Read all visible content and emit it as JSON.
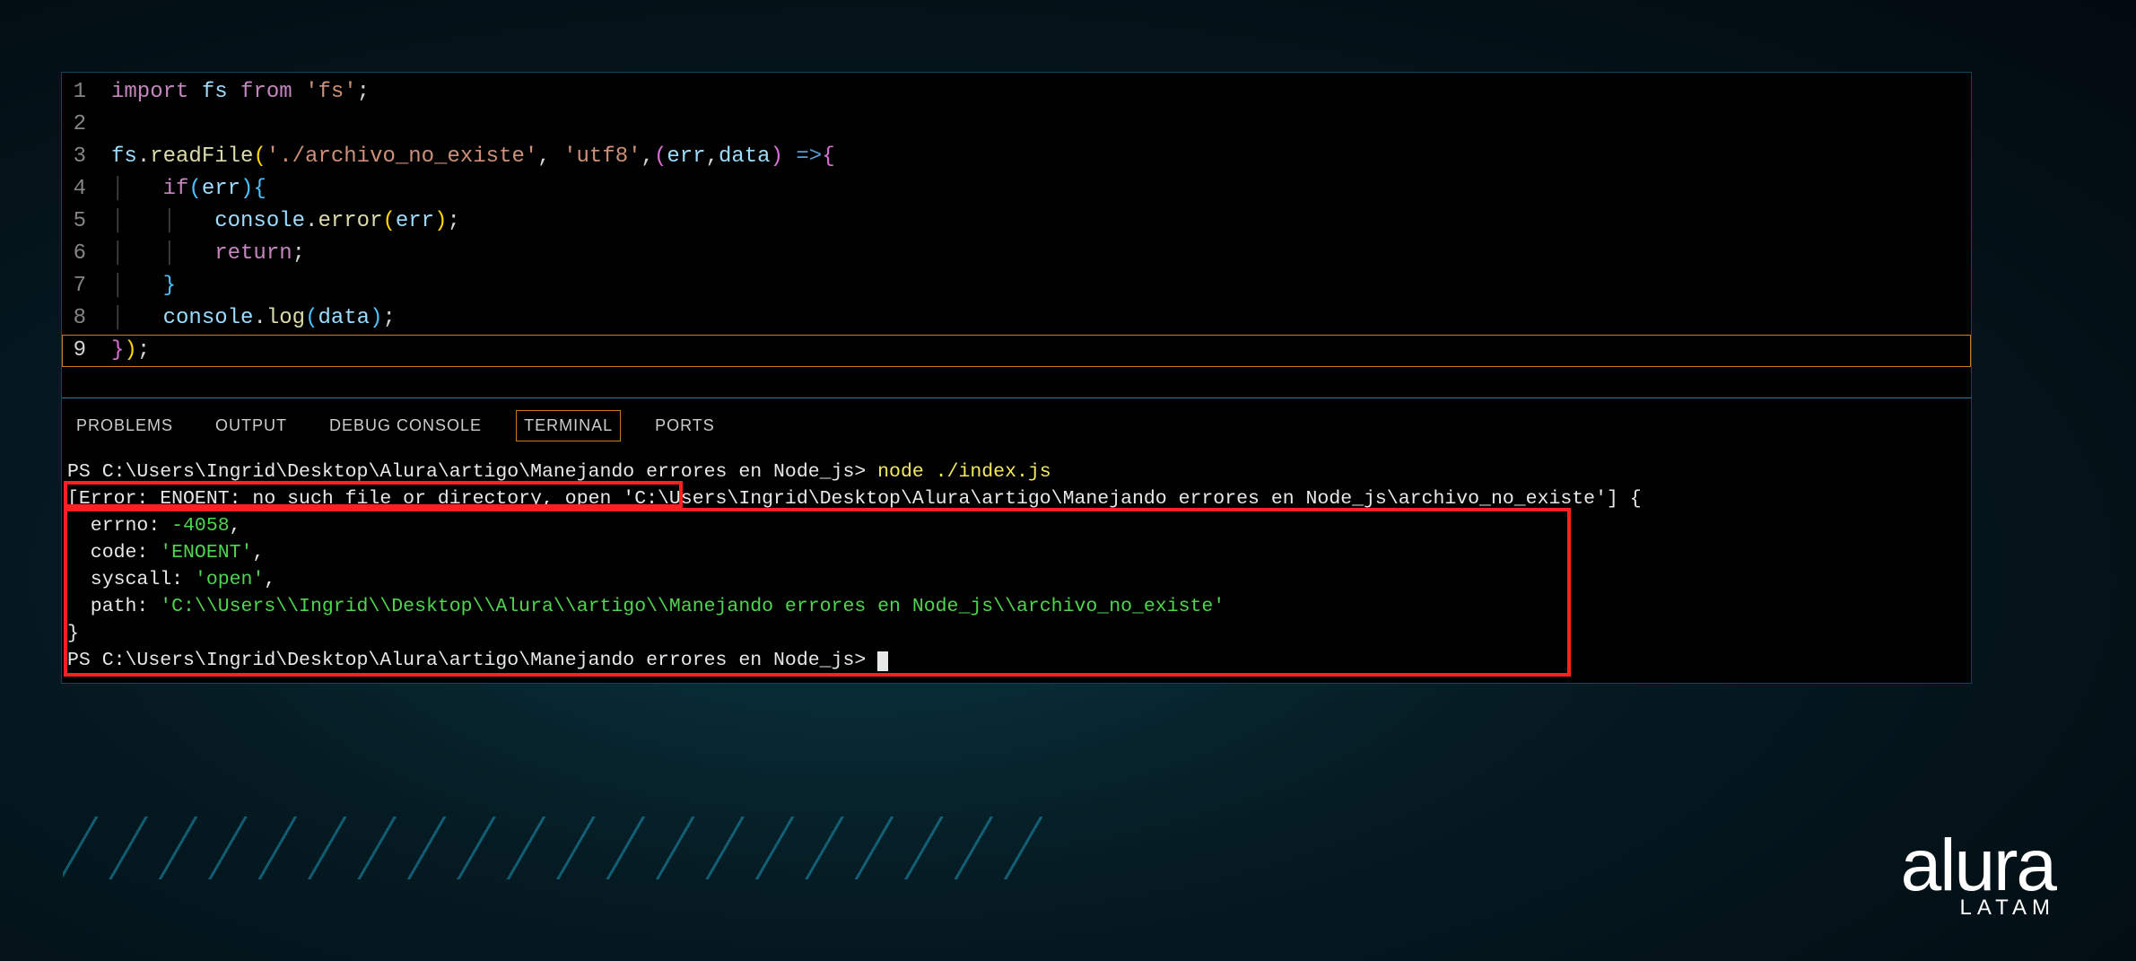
{
  "editor": {
    "lines": [
      {
        "n": "1"
      },
      {
        "n": "2"
      },
      {
        "n": "3"
      },
      {
        "n": "4"
      },
      {
        "n": "5"
      },
      {
        "n": "6"
      },
      {
        "n": "7"
      },
      {
        "n": "8"
      },
      {
        "n": "9"
      }
    ],
    "tokens": {
      "import": "import",
      "fs_ident": "fs",
      "from": "from",
      "fs_str": "'fs'",
      "semi": ";",
      "readFile": "readFile",
      "path_str": "'./archivo_no_existe'",
      "utf8_str": "'utf8'",
      "err": "err",
      "data": "data",
      "if": "if",
      "console": "console",
      "error_fn": "error",
      "log_fn": "log",
      "return": "return"
    }
  },
  "tabs": {
    "problems": "PROBLEMS",
    "output": "OUTPUT",
    "debug": "DEBUG CONSOLE",
    "terminal": "TERMINAL",
    "ports": "PORTS"
  },
  "terminal": {
    "prompt1_pre": "PS C:\\Users\\Ingrid\\Desktop\\Alura\\artigo\\Manejando errores en Node_js> ",
    "cmd": "node ./index.js",
    "err_open": "[Error: ENOENT: no such file or directory, open 'C:\\Users\\Ingrid\\Desktop\\Alura\\artigo\\Manejando errores en Node_js\\archivo_no_existe'] {",
    "errno_label": "  errno: ",
    "errno_val": "-4058",
    "comma": ",",
    "code_label": "  code: ",
    "code_val": "'ENOENT'",
    "syscall_label": "  syscall: ",
    "syscall_val": "'open'",
    "path_label": "  path: ",
    "path_val": "'C:\\\\Users\\\\Ingrid\\\\Desktop\\\\Alura\\\\artigo\\\\Manejando errores en Node_js\\\\archivo_no_existe'",
    "close_brace": "}",
    "prompt2": "PS C:\\Users\\Ingrid\\Desktop\\Alura\\artigo\\Manejando errores en Node_js> "
  },
  "logo": {
    "main": "alura",
    "sub": "LATAM"
  }
}
